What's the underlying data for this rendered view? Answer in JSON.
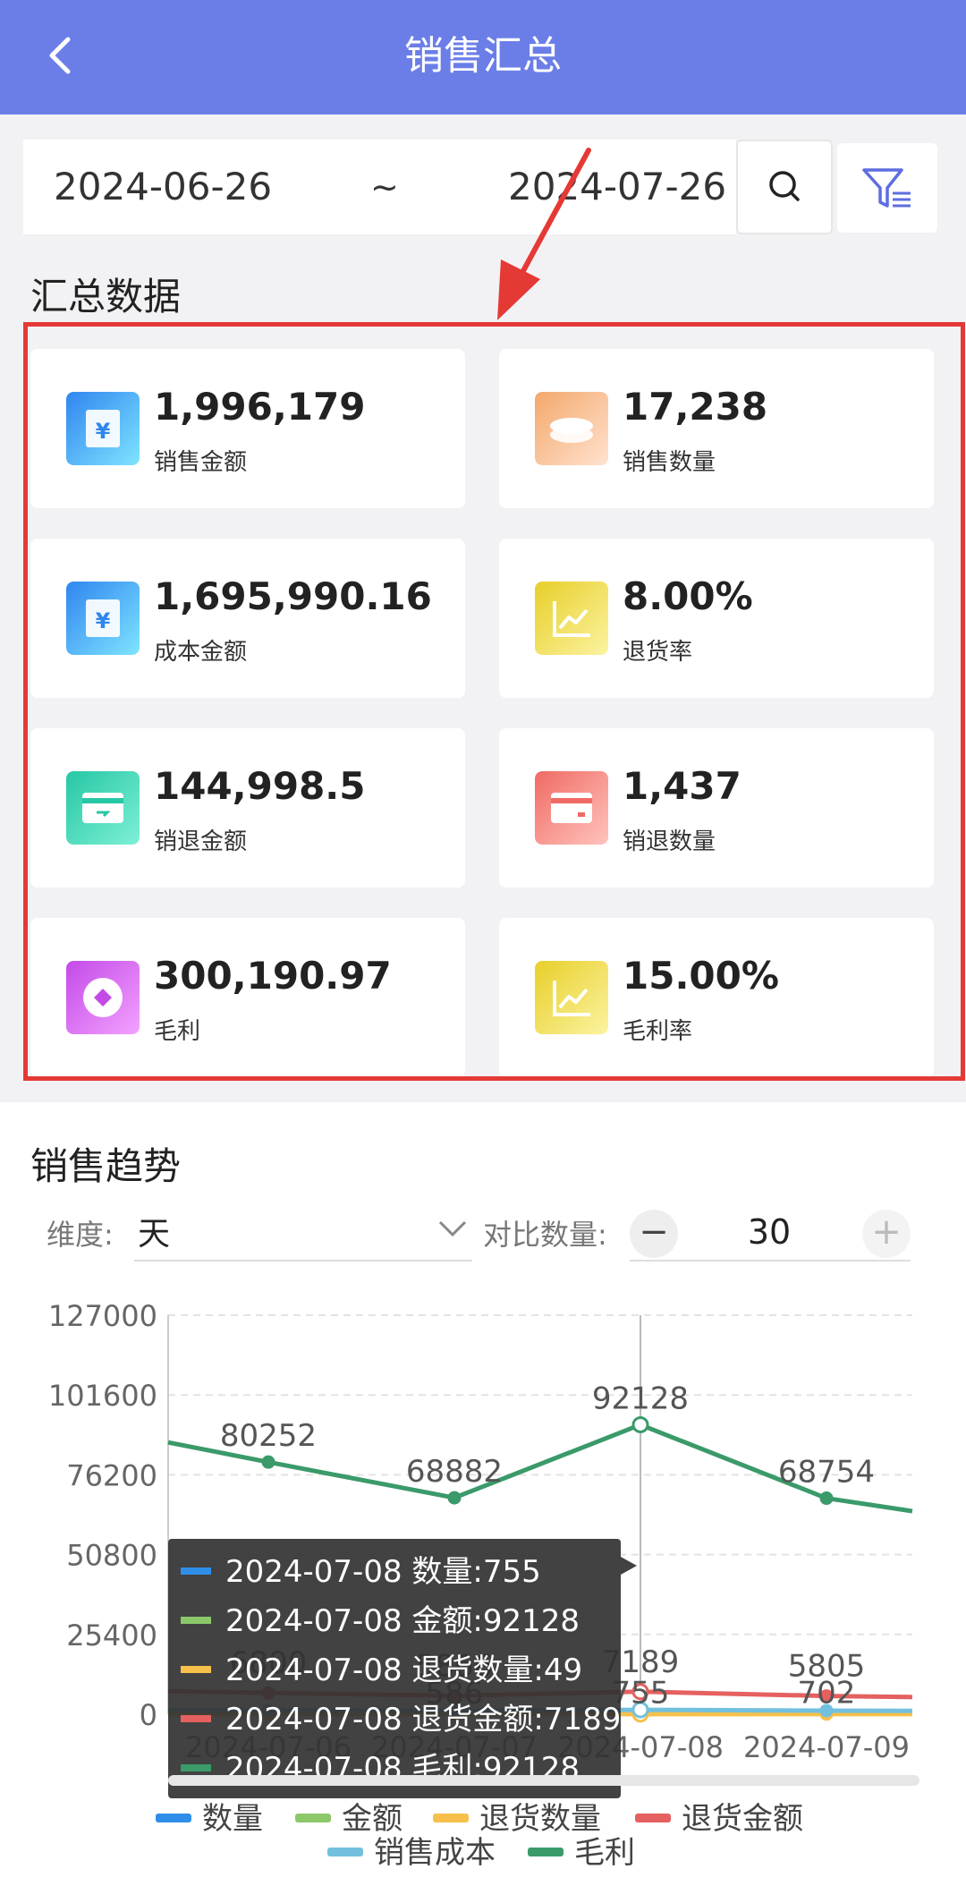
{
  "header": {
    "title": "销售汇总"
  },
  "filter": {
    "start_date": "2024-06-26",
    "separator": "~",
    "end_date": "2024-07-26"
  },
  "summary": {
    "title": "汇总数据",
    "cards": [
      {
        "value": "1,996,179",
        "label": "销售金额",
        "icon": "yuan-icon"
      },
      {
        "value": "17,238",
        "label": "销售数量",
        "icon": "coins-icon"
      },
      {
        "value": "1,695,990.16",
        "label": "成本金额",
        "icon": "yuan-icon"
      },
      {
        "value": "8.00%",
        "label": "退货率",
        "icon": "trend-icon"
      },
      {
        "value": "144,998.5",
        "label": "销退金额",
        "icon": "card-icon"
      },
      {
        "value": "1,437",
        "label": "销退数量",
        "icon": "card-icon"
      },
      {
        "value": "300,190.97",
        "label": "毛利",
        "icon": "diamond-icon"
      },
      {
        "value": "15.00%",
        "label": "毛利率",
        "icon": "trend-icon"
      }
    ]
  },
  "trend": {
    "title": "销售趋势",
    "dimension_label": "维度:",
    "dimension_value": "天",
    "compare_label": "对比数量:",
    "compare_value": "30",
    "minus": "−",
    "plus": "+"
  },
  "chart_data": {
    "type": "line",
    "x": [
      "2024-07-06",
      "2024-07-07",
      "2024-07-08",
      "2024-07-09"
    ],
    "ylim": [
      0,
      127000
    ],
    "y_ticks": [
      "127000",
      "101600",
      "76200",
      "50800",
      "25400",
      "0"
    ],
    "grid": true,
    "legend": "bottom",
    "series": [
      {
        "name": "数量",
        "color": "#2f8fe8",
        "values": [
          690,
          586,
          755,
          702
        ]
      },
      {
        "name": "金额",
        "color": "#8cc86a",
        "values": [
          80252,
          68882,
          92128,
          68754
        ]
      },
      {
        "name": "退货数量",
        "color": "#f6c04a",
        "values": [
          60,
          56,
          49,
          52
        ]
      },
      {
        "name": "退货金额",
        "color": "#e56060",
        "values": [
          6800,
          5866,
          7189,
          5805
        ]
      },
      {
        "name": "销售成本",
        "color": "#73c0de",
        "values": [
          1200,
          1100,
          1400,
          1150
        ]
      },
      {
        "name": "毛利",
        "color": "#3a9a6a",
        "values": [
          80252,
          68882,
          92128,
          68754
        ]
      }
    ],
    "point_labels": [
      {
        "series": "毛利",
        "index": 0,
        "text": "80252"
      },
      {
        "series": "毛利",
        "index": 1,
        "text": "68882"
      },
      {
        "series": "毛利",
        "index": 2,
        "text": "92128"
      },
      {
        "series": "毛利",
        "index": 3,
        "text": "68754"
      },
      {
        "series": "退货金额",
        "index": 0,
        "text": "6800"
      },
      {
        "series": "退货金额",
        "index": 1,
        "text": "5866"
      },
      {
        "series": "退货金额",
        "index": 2,
        "text": "7189"
      },
      {
        "series": "退货金额",
        "index": 3,
        "text": "5805"
      },
      {
        "series": "数量",
        "index": 1,
        "text": "586"
      },
      {
        "series": "数量",
        "index": 2,
        "text": "755"
      },
      {
        "series": "数量",
        "index": 3,
        "text": "702"
      }
    ],
    "tooltip": [
      {
        "color": "#2f8fe8",
        "text": "2024-07-08 数量:755"
      },
      {
        "color": "#8cc86a",
        "text": "2024-07-08 金额:92128"
      },
      {
        "color": "#f6c04a",
        "text": "2024-07-08 退货数量:49"
      },
      {
        "color": "#e56060",
        "text": "2024-07-08 退货金额:7189"
      },
      {
        "color": "#3a9a6a",
        "text": "2024-07-08 毛利:92128"
      }
    ]
  }
}
